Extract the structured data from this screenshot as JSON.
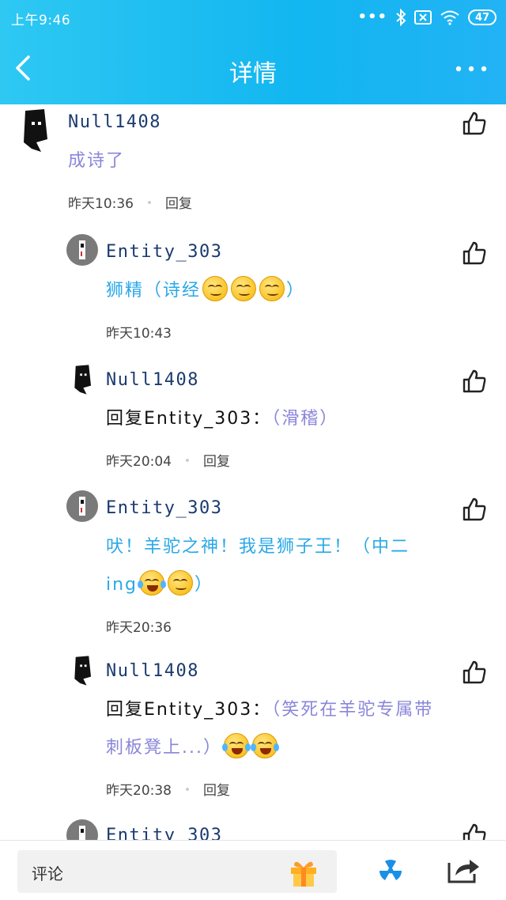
{
  "status_bar": {
    "time": "上午9:46",
    "battery": "47"
  },
  "header": {
    "title": "详情"
  },
  "comments": [
    {
      "user": "Null1408",
      "text": "成诗了",
      "time": "昨天10:36",
      "reply_label": "回复"
    },
    {
      "user": "Entity_303",
      "text": "狮精（诗经",
      "text_end": "）",
      "time": "昨天10:43"
    },
    {
      "user": "Null1408",
      "reply_prefix": "回复Entity_303：",
      "reply_text": "（滑稽）",
      "time": "昨天20:04",
      "reply_label": "回复"
    },
    {
      "user": "Entity_303",
      "line1": "吠！羊驼之神！我是狮子王！（中二",
      "line2_start": "ing",
      "line2_end": "）",
      "time": "昨天20:36"
    },
    {
      "user": "Null1408",
      "reply_prefix": "回复Entity_303：",
      "reply_text_line1": "（笑死在羊驼专属带",
      "reply_text_line2": "刺板凳上...）",
      "time": "昨天20:38",
      "reply_label": "回复"
    },
    {
      "user": "Entity_303"
    }
  ],
  "bottom_bar": {
    "placeholder": "评论"
  },
  "colors": {
    "header": "#12b6f0",
    "username": "#1a3a6e",
    "purple_text": "#8a86d9",
    "cyan_text": "#2aa8e8"
  }
}
